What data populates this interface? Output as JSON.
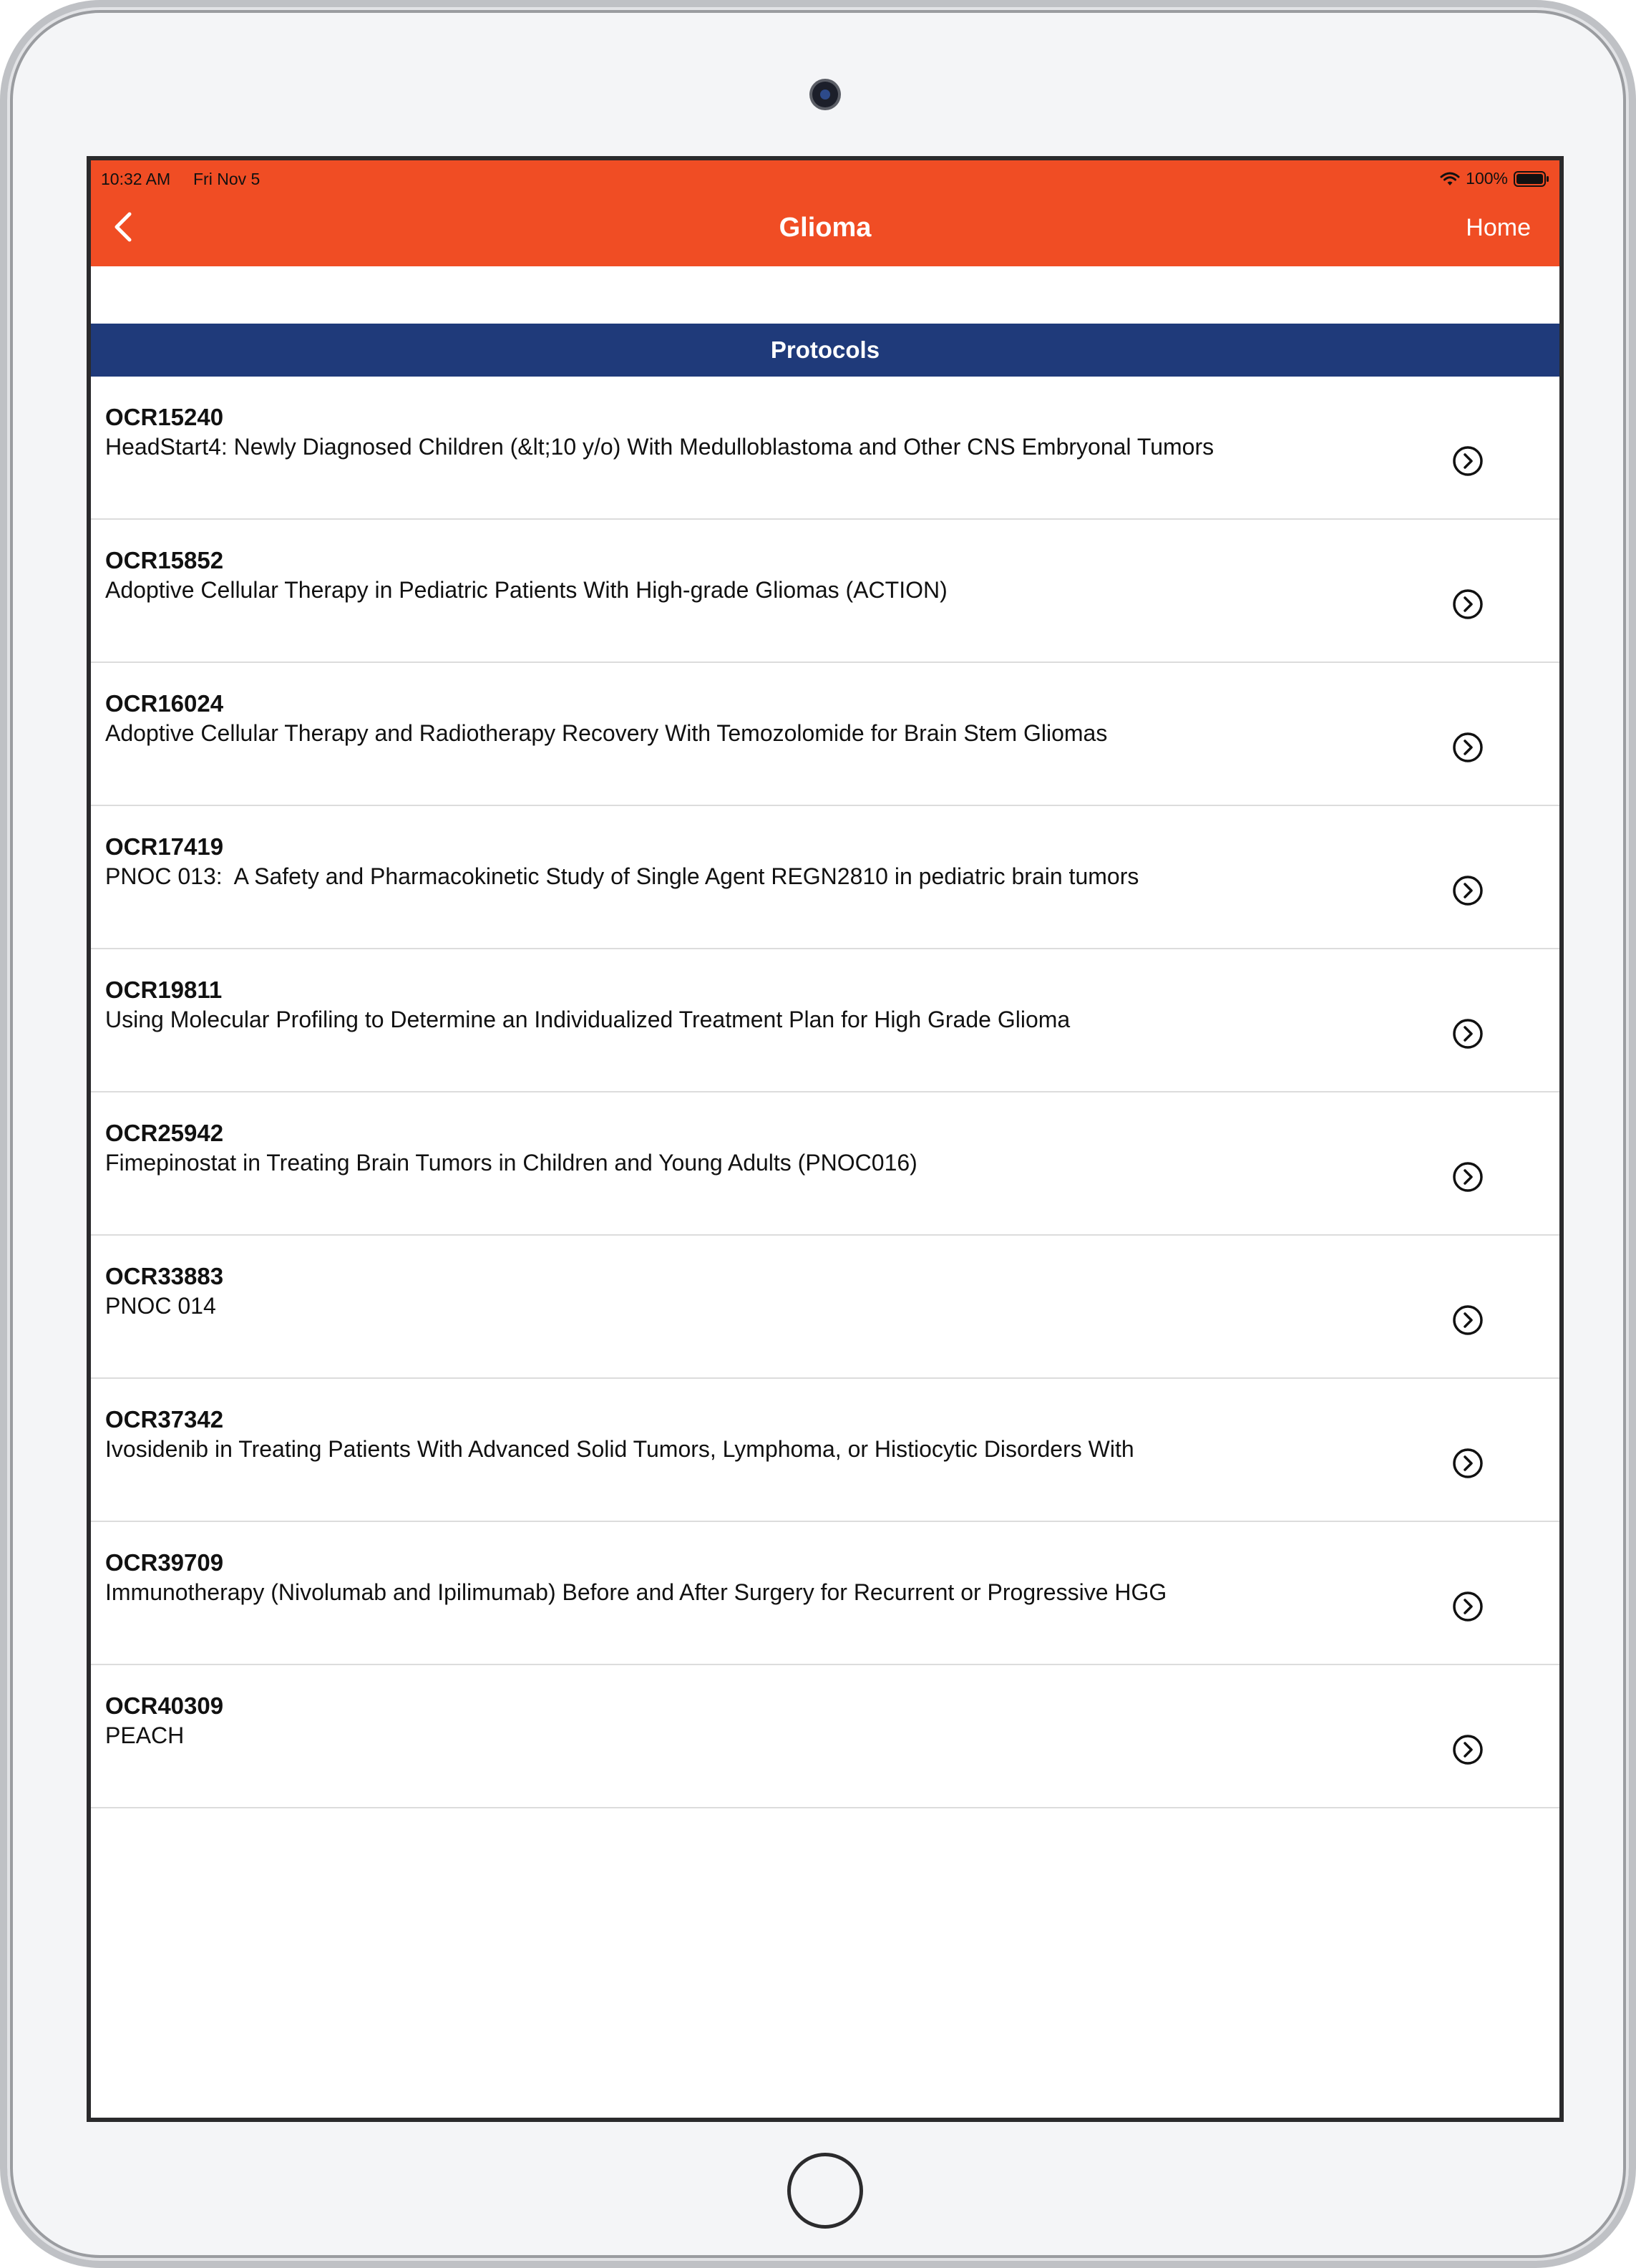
{
  "status_bar": {
    "time": "10:32 AM",
    "date": "Fri Nov 5",
    "battery": "100%"
  },
  "nav": {
    "title": "Glioma",
    "home_label": "Home"
  },
  "section": {
    "title": "Protocols"
  },
  "protocols": [
    {
      "id": "OCR15240",
      "title": "HeadStart4: Newly Diagnosed Children (&lt;10 y/o) With Medulloblastoma and Other CNS Embryonal Tumors"
    },
    {
      "id": "OCR15852",
      "title": "Adoptive Cellular Therapy in Pediatric Patients With High-grade Gliomas (ACTION)"
    },
    {
      "id": "OCR16024",
      "title": "Adoptive Cellular Therapy and Radiotherapy Recovery With Temozolomide for Brain Stem Gliomas"
    },
    {
      "id": "OCR17419",
      "title": "PNOC 013:  A Safety and Pharmacokinetic Study of Single Agent REGN2810 in pediatric brain tumors"
    },
    {
      "id": "OCR19811",
      "title": "Using Molecular Profiling to Determine an Individualized Treatment Plan for High Grade Glioma"
    },
    {
      "id": "OCR25942",
      "title": "Fimepinostat in Treating Brain Tumors in Children and Young Adults (PNOC016)"
    },
    {
      "id": "OCR33883",
      "title": "PNOC 014"
    },
    {
      "id": "OCR37342",
      "title": "Ivosidenib in Treating Patients With Advanced Solid Tumors, Lymphoma, or Histiocytic Disorders With"
    },
    {
      "id": "OCR39709",
      "title": "Immunotherapy (Nivolumab and Ipilimumab) Before and After Surgery for Recurrent or Progressive HGG"
    },
    {
      "id": "OCR40309",
      "title": "PEACH"
    }
  ],
  "colors": {
    "header": "#f04d24",
    "section_header": "#1f3a7a"
  }
}
